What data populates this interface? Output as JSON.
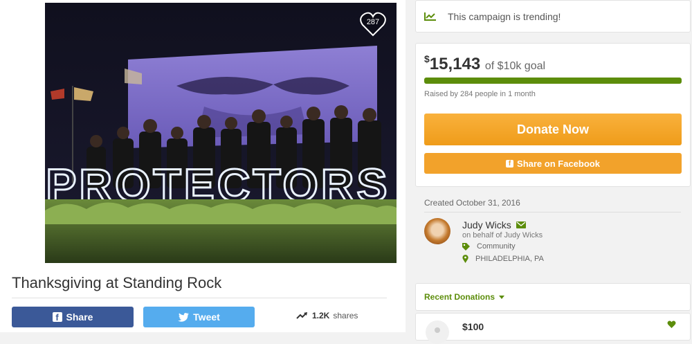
{
  "campaign": {
    "title": "Thanksgiving at Standing Rock",
    "photo_text": "PROTECTORS",
    "hearts_count": "287",
    "share_button_label": "Share",
    "tweet_button_label": "Tweet",
    "shares_count": "1.2K",
    "shares_label": "shares"
  },
  "trending": {
    "icon": "trending-up-icon",
    "text": "This campaign is trending!"
  },
  "funding": {
    "currency_symbol": "$",
    "raised_amount": "15,143",
    "goal_text": "of $10k goal",
    "progress_fraction": 1.0,
    "raised_by": "Raised by 284 people in 1 month",
    "donate_label": "Donate Now",
    "share_facebook_label": "Share on Facebook"
  },
  "organizer": {
    "created": "Created October 31, 2016",
    "name": "Judy Wicks",
    "behalf": "on behalf of Judy Wicks",
    "category": "Community",
    "location": "PHILADELPHIA, PA"
  },
  "recent_donations": {
    "label": "Recent Donations",
    "items": [
      {
        "amount": "$100"
      }
    ]
  },
  "colors": {
    "accent_green": "#5c8d0b",
    "donate_orange": "#f5a623",
    "facebook_blue": "#3b5998",
    "twitter_blue": "#55acee"
  }
}
